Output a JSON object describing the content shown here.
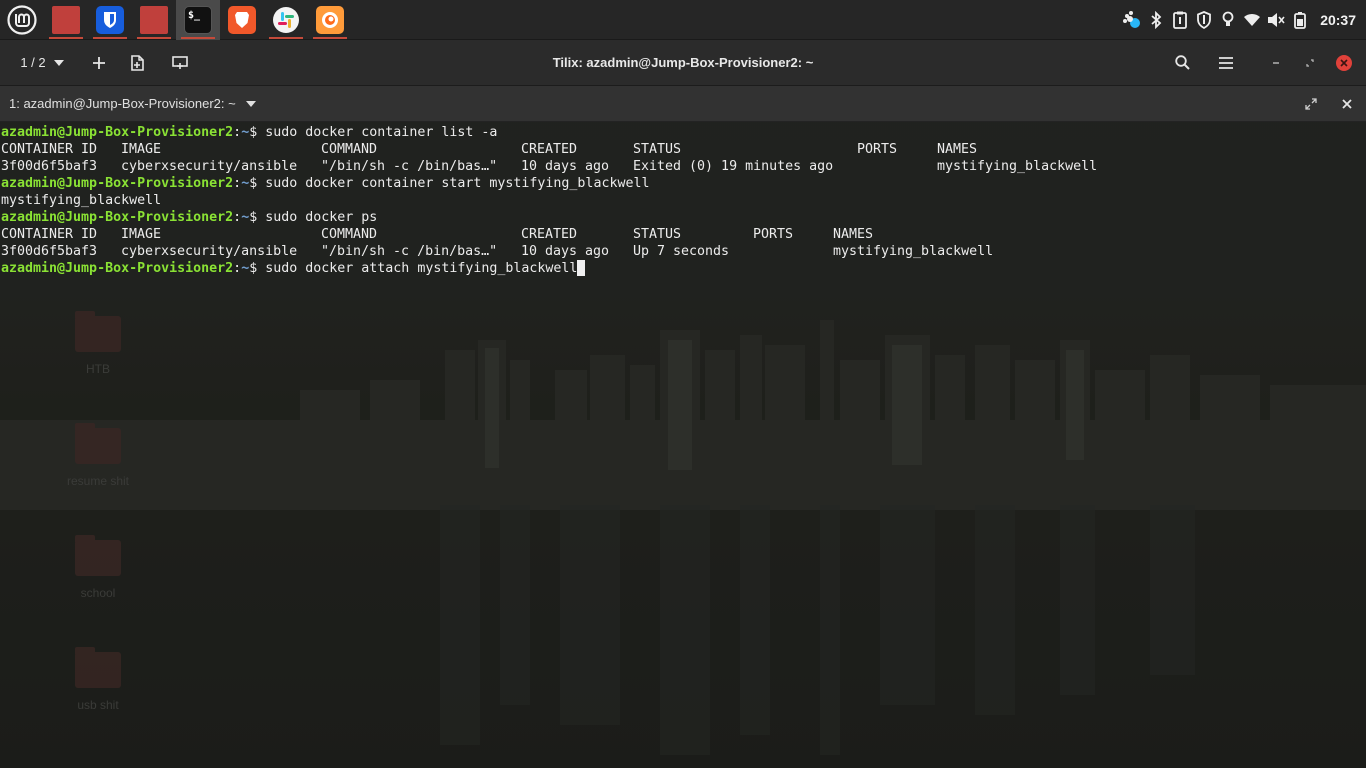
{
  "panel": {
    "launchers": [
      {
        "name": "mint-menu",
        "icon": "linux-mint-logo-icon"
      },
      {
        "name": "files",
        "icon": "folder-icon"
      },
      {
        "name": "bitwarden",
        "icon": "shield-icon"
      },
      {
        "name": "files-2",
        "icon": "folder-icon"
      },
      {
        "name": "terminal",
        "icon": "terminal-icon",
        "glyph": "$_"
      },
      {
        "name": "brave",
        "icon": "lion-icon"
      },
      {
        "name": "slack",
        "icon": "hash-icon"
      },
      {
        "name": "firefox",
        "icon": "fox-icon"
      }
    ],
    "tray": [
      "paw-icon",
      "bluetooth-icon",
      "clipboard-icon",
      "shield-status-icon",
      "bulb-icon",
      "wifi-icon",
      "speaker-muted-icon",
      "battery-icon"
    ],
    "clock": "20:37"
  },
  "window": {
    "session_counter": "1 / 2",
    "title": "Tilix: azadmin@Jump-Box-Provisioner2: ~",
    "tab_title": "1: azadmin@Jump-Box-Provisioner2: ~"
  },
  "desktop": {
    "icons": [
      "HTB",
      "resume shit",
      "school",
      "usb shit"
    ]
  },
  "terminal": {
    "prompt_user": "azadmin@Jump-Box-Provisioner2",
    "prompt_path": "~",
    "prompt_sep": ":",
    "prompt_end": "$ ",
    "cmd1": "sudo docker container list -a",
    "table1": {
      "headers": [
        "CONTAINER ID",
        "IMAGE",
        "COMMAND",
        "CREATED",
        "STATUS",
        "PORTS",
        "NAMES"
      ],
      "row": [
        "3f00d6f5baf3",
        "cyberxsecurity/ansible",
        "\"/bin/sh -c /bin/bas…\"",
        "10 days ago",
        "Exited (0) 19 minutes ago",
        "",
        "mystifying_blackwell"
      ]
    },
    "cmd2": "sudo docker container start mystifying_blackwell",
    "out2": "mystifying_blackwell",
    "cmd3": "sudo docker ps",
    "table2": {
      "headers": [
        "CONTAINER ID",
        "IMAGE",
        "COMMAND",
        "CREATED",
        "STATUS",
        "PORTS",
        "NAMES"
      ],
      "row": [
        "3f00d6f5baf3",
        "cyberxsecurity/ansible",
        "\"/bin/sh -c /bin/bas…\"",
        "10 days ago",
        "Up 7 seconds",
        "",
        "mystifying_blackwell"
      ]
    },
    "cmd4": "sudo docker attach mystifying_blackwell"
  },
  "colors": {
    "prompt_user": "#8ae234",
    "prompt_path": "#729fcf",
    "running_indicator": "#c44a3a"
  }
}
